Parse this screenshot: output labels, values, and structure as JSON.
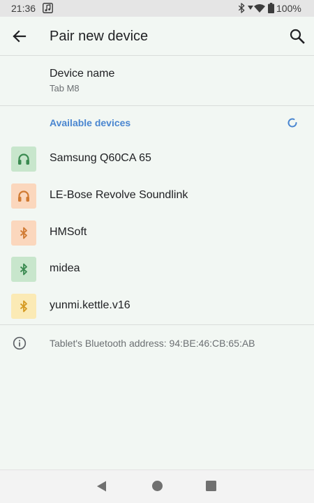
{
  "status_bar": {
    "time": "21:36",
    "battery": "100%",
    "icons": [
      "music-note-icon",
      "bluetooth-icon",
      "signal-icon",
      "wifi-icon",
      "battery-icon"
    ]
  },
  "toolbar": {
    "title": "Pair new device",
    "back_icon": "arrow-back-icon",
    "search_icon": "search-icon"
  },
  "device_name": {
    "label": "Device name",
    "value": "Tab M8"
  },
  "available": {
    "header": "Available devices",
    "refresh_icon": "refresh-icon",
    "devices": [
      {
        "label": "Samsung Q60CA 65",
        "icon": "headphones-icon",
        "bg": "#c8e6cc",
        "fg": "#3a8a50"
      },
      {
        "label": "LE-Bose Revolve Soundlink",
        "icon": "headphones-icon",
        "bg": "#fbd7bd",
        "fg": "#d07a32"
      },
      {
        "label": "HMSoft",
        "icon": "bluetooth-icon",
        "bg": "#fbd7bd",
        "fg": "#d07a32"
      },
      {
        "label": "midea",
        "icon": "bluetooth-icon",
        "bg": "#c8e6cc",
        "fg": "#3a8a50"
      },
      {
        "label": "yunmi.kettle.v16",
        "icon": "bluetooth-icon",
        "bg": "#fbeab5",
        "fg": "#d59a22"
      }
    ]
  },
  "footer": {
    "info_icon": "info-icon",
    "address": "Tablet's Bluetooth address: 94:BE:46:CB:65:AB"
  },
  "nav_bar": {
    "icons": [
      "nav-back-icon",
      "nav-home-icon",
      "nav-recents-icon"
    ]
  },
  "colors": {
    "background": "#f2f7f3",
    "accent": "#4a86d0",
    "status_bar": "#e5e5e5"
  }
}
